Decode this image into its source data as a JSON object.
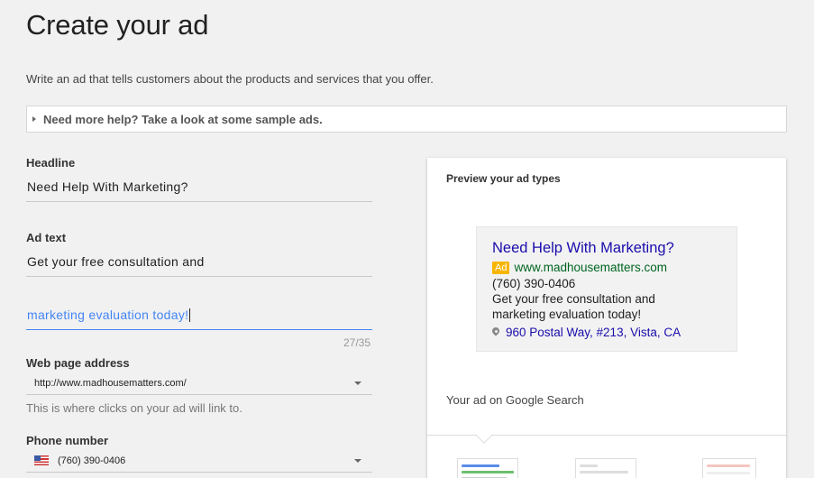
{
  "page": {
    "title": "Create your ad",
    "subtitle": "Write an ad that tells customers about the products and services that you offer.",
    "help_link": "Need more help? Take a look at some sample ads."
  },
  "form": {
    "headline_label": "Headline",
    "headline_value": "Need Help With Marketing?",
    "ad_text_label": "Ad text",
    "ad_text_line1": "Get your free consultation and",
    "ad_text_line2": "marketing evaluation today!",
    "char_counter": "27/35",
    "web_label": "Web page address",
    "web_value": "http://www.madhousematters.com/",
    "web_hint": "This is where clicks on your ad will link to.",
    "phone_label": "Phone number",
    "phone_value": "(760) 390-0406"
  },
  "preview": {
    "title": "Preview your ad types",
    "ad_headline": "Need Help With Marketing?",
    "ad_badge": "Ad",
    "ad_url": "www.madhousematters.com",
    "ad_phone": "(760) 390-0406",
    "ad_line1": "Get your free consultation and",
    "ad_line2": "marketing evaluation today!",
    "ad_address": "960 Postal Way, #213, Vista, CA",
    "search_label": "Your ad on Google Search"
  },
  "colors": {
    "focus": "#4285f4",
    "ad_headline": "#1a0dab",
    "ad_url": "#006621",
    "ad_badge": "#f7b500"
  }
}
